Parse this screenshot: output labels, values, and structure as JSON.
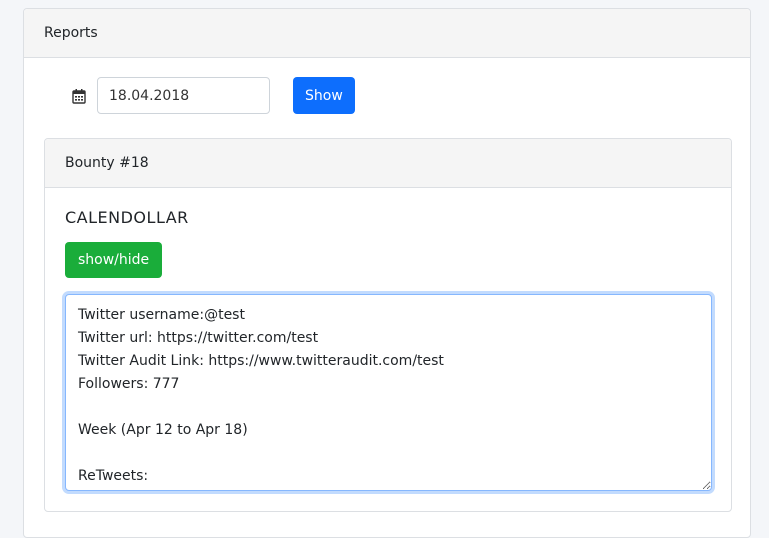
{
  "reports_panel": {
    "title": "Reports",
    "date_value": "18.04.2018",
    "show_label": "Show",
    "calendar_icon": "calendar-icon"
  },
  "bounty": {
    "header": "Bounty #18",
    "company": "CALENDOLLAR",
    "toggle_label": "show/hide",
    "report_text": "Twitter username:@test\nTwitter url: https://twitter.com/test\nTwitter Audit Link: https://www.twitteraudit.com/test\nFollowers: 777\n\nWeek (Apr 12 to Apr 18)\n\nReTweets:"
  },
  "colors": {
    "primary": "#0d6efd",
    "success": "#1aad3a",
    "header_bg": "#f5f5f5",
    "page_bg": "#f4f6f9"
  }
}
